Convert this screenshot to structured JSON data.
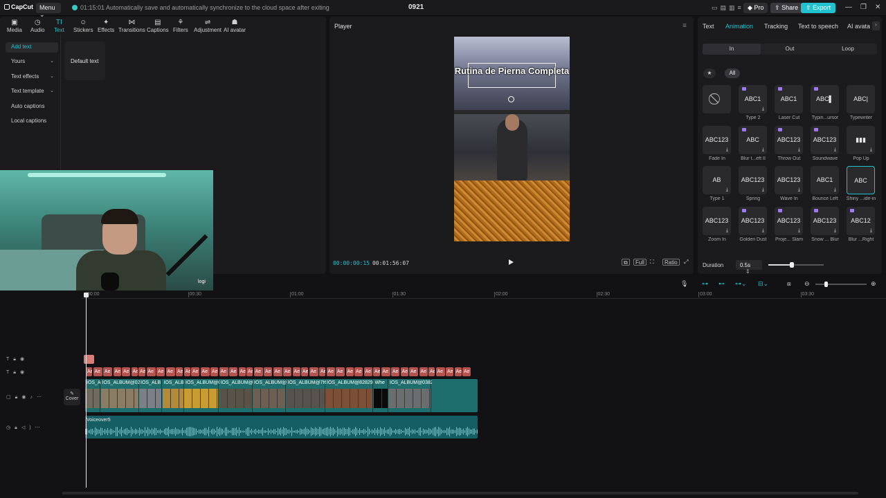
{
  "titlebar": {
    "app_name": "CapCut",
    "menu_label": "Menu",
    "save_note": "01:15:01 Automatically save and automatically synchronize to the cloud space after exiting",
    "project_name": "0921",
    "pro_label": "Pro",
    "share_label": "Share",
    "export_label": "Export",
    "icons": [
      "layout-icon",
      "panel-icon",
      "panel-icon",
      "menu-icon"
    ]
  },
  "toolbar": {
    "tools": [
      {
        "label": "Media",
        "icon": "▣"
      },
      {
        "label": "Audio",
        "icon": "◷"
      },
      {
        "label": "Text",
        "icon": "TI"
      },
      {
        "label": "Stickers",
        "icon": "☺"
      },
      {
        "label": "Effects",
        "icon": "✦"
      },
      {
        "label": "Transitions",
        "icon": "⋈"
      },
      {
        "label": "Captions",
        "icon": "▤"
      },
      {
        "label": "Filters",
        "icon": "⚘"
      },
      {
        "label": "Adjustment",
        "icon": "⇌"
      },
      {
        "label": "AI avatar",
        "icon": "☗"
      }
    ],
    "active_tool": "Text"
  },
  "sidebar": {
    "items": [
      {
        "label": "Add text",
        "chevron": ""
      },
      {
        "label": "Yours",
        "chevron": "⌄"
      },
      {
        "label": "Text effects",
        "chevron": "⌄"
      },
      {
        "label": "Text template",
        "chevron": "⌄"
      },
      {
        "label": "Auto captions",
        "chevron": ""
      },
      {
        "label": "Local captions",
        "chevron": ""
      }
    ]
  },
  "text_panel": {
    "default_card_label": "Default text"
  },
  "webcam": {
    "tag": "logi"
  },
  "player": {
    "title": "Player",
    "overlay_title": "Rutina de Pierna Completa",
    "current_time": "00:00:00:15",
    "total_time": "00:01:56:07",
    "tools": [
      "⧉",
      "Full",
      "⛶",
      "Ratio",
      "⤢"
    ]
  },
  "right_panel": {
    "tabs": [
      "Text",
      "Animation",
      "Tracking",
      "Text to speech",
      "AI avata"
    ],
    "active_tab": "Animation",
    "segments": [
      "In",
      "Out",
      "Loop"
    ],
    "active_segment": "In",
    "filter_all": "All",
    "animations": [
      {
        "label": "",
        "thumb": "⃠",
        "pro": false,
        "download": false
      },
      {
        "label": "Type 2",
        "thumb": "ABC1",
        "pro": true,
        "download": true
      },
      {
        "label": "Laser Cut",
        "thumb": "ABC1",
        "pro": true,
        "download": false
      },
      {
        "label": "Typin...ursor",
        "thumb": "ABC▌",
        "pro": true,
        "download": false
      },
      {
        "label": "Typewriter",
        "thumb": "ABC|",
        "pro": false,
        "download": false
      },
      {
        "label": "Fade In",
        "thumb": "ABC123",
        "pro": false,
        "download": true
      },
      {
        "label": "Blur t...eft II",
        "thumb": "ABC",
        "pro": true,
        "download": true
      },
      {
        "label": "Throw Out",
        "thumb": "ABC123",
        "pro": true,
        "download": true
      },
      {
        "label": "Soundwave",
        "thumb": "ABC123",
        "pro": true,
        "download": true
      },
      {
        "label": "Pop Up",
        "thumb": "▮▮▮",
        "pro": false,
        "download": true
      },
      {
        "label": "Type 1",
        "thumb": "AB",
        "pro": false,
        "download": true
      },
      {
        "label": "Spring",
        "thumb": "ABC123",
        "pro": false,
        "download": true
      },
      {
        "label": "Wave In",
        "thumb": "ABC123",
        "pro": false,
        "download": true
      },
      {
        "label": "Bounce Left",
        "thumb": "ABC1",
        "pro": false,
        "download": true
      },
      {
        "label": "Shiny ...ide-in",
        "thumb": "ABC",
        "pro": false,
        "download": false,
        "selected": true
      },
      {
        "label": "Zoom In",
        "thumb": "ABC123",
        "pro": false,
        "download": true
      },
      {
        "label": "Golden Dust",
        "thumb": "ABC123",
        "pro": true,
        "download": true
      },
      {
        "label": "Proje... Slam",
        "thumb": "ABC123",
        "pro": true,
        "download": true
      },
      {
        "label": "Snow ... Blur",
        "thumb": "ABC123",
        "pro": true,
        "download": true
      },
      {
        "label": "Blur ...Right",
        "thumb": "ABC12",
        "pro": true,
        "download": true
      }
    ],
    "duration_label": "Duration",
    "duration_value": "0.5s",
    "duration_slider_level": 0.42
  },
  "timeline": {
    "ruler_labels": [
      "00:00",
      "00:30",
      "01:00",
      "01:30",
      "02:00",
      "02:30",
      "03:00",
      "03:30"
    ],
    "cover_label": "Cover",
    "text_track_label": "Ae",
    "video_clips": [
      "IOS_A",
      "IOS_ALBUM@02",
      "IOS_ALB",
      "IOS_ALB",
      "IOS_ALBUM@C3935",
      "IOS_ALBUM@",
      "IOS_ALBUM@",
      "IOS_ALBUM@7f6",
      "IOS_ALBUM@82829",
      "Whe",
      "IOS_ALBUM@0382"
    ],
    "audio_clip_name": "Voiceover5",
    "zoom_level": 0.18,
    "colors": {
      "text_clip": "#b5534e",
      "video": "#1d6e6c",
      "audio": "#155e63",
      "accent": "#22c1cf"
    }
  }
}
